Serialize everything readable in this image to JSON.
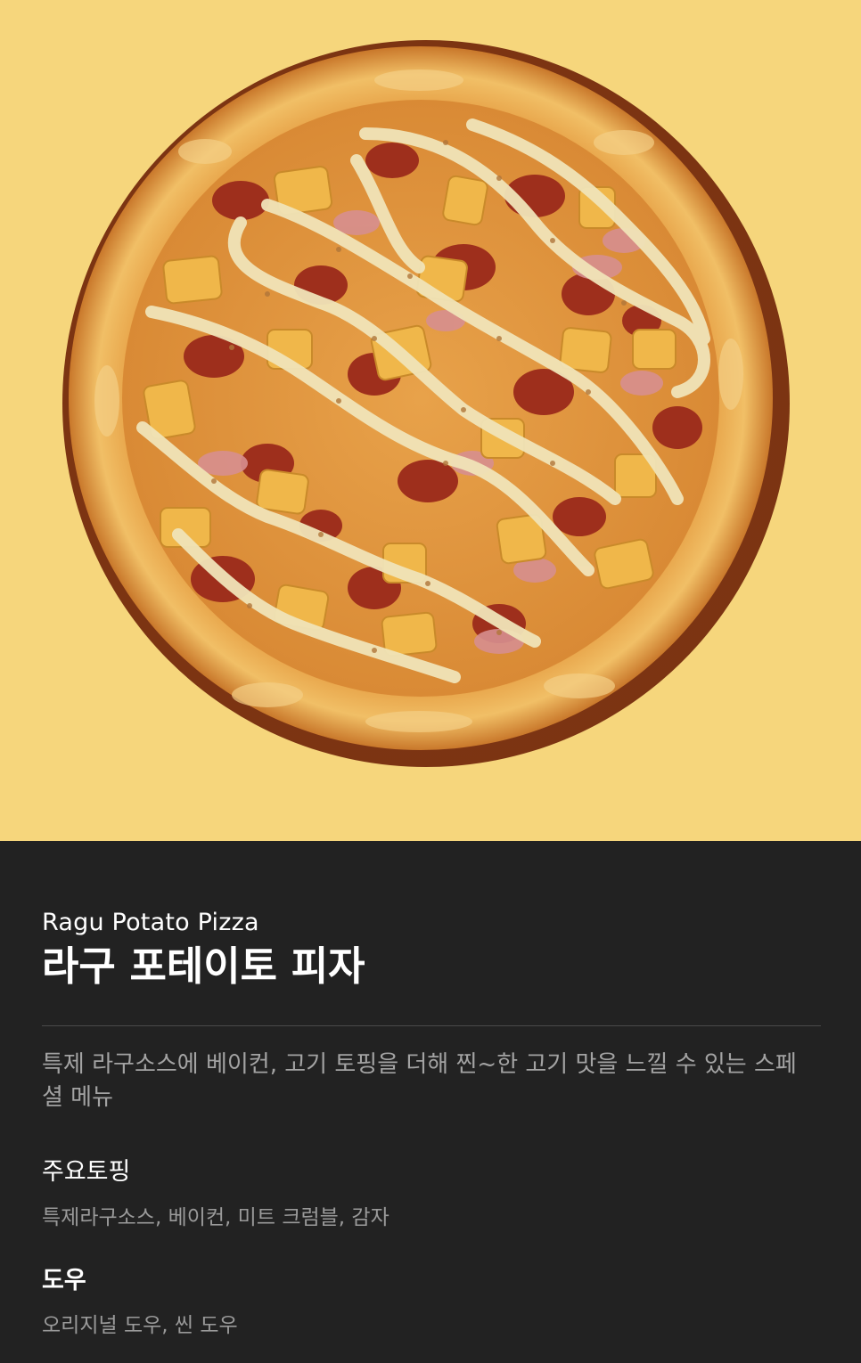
{
  "hero": {
    "image_subject": "pizza-photo",
    "background_color": "#f6d67c"
  },
  "product": {
    "name_en": "Ragu Potato Pizza",
    "name_ko": "라구 포테이토 피자",
    "description": "특제 라구소스에 베이컨, 고기 토핑을 더해 찐~한 고기 맛을 느낄 수 있는 스페셜 메뉴"
  },
  "toppings": {
    "title": "주요토핑",
    "text": "특제라구소스, 베이컨, 미트 크럼블, 감자"
  },
  "dough": {
    "title": "도우",
    "text": "오리지널 도우, 씬 도우"
  },
  "colors": {
    "panel_background": "#222222",
    "text_primary": "#ffffff",
    "text_secondary": "#a3a3a3"
  }
}
